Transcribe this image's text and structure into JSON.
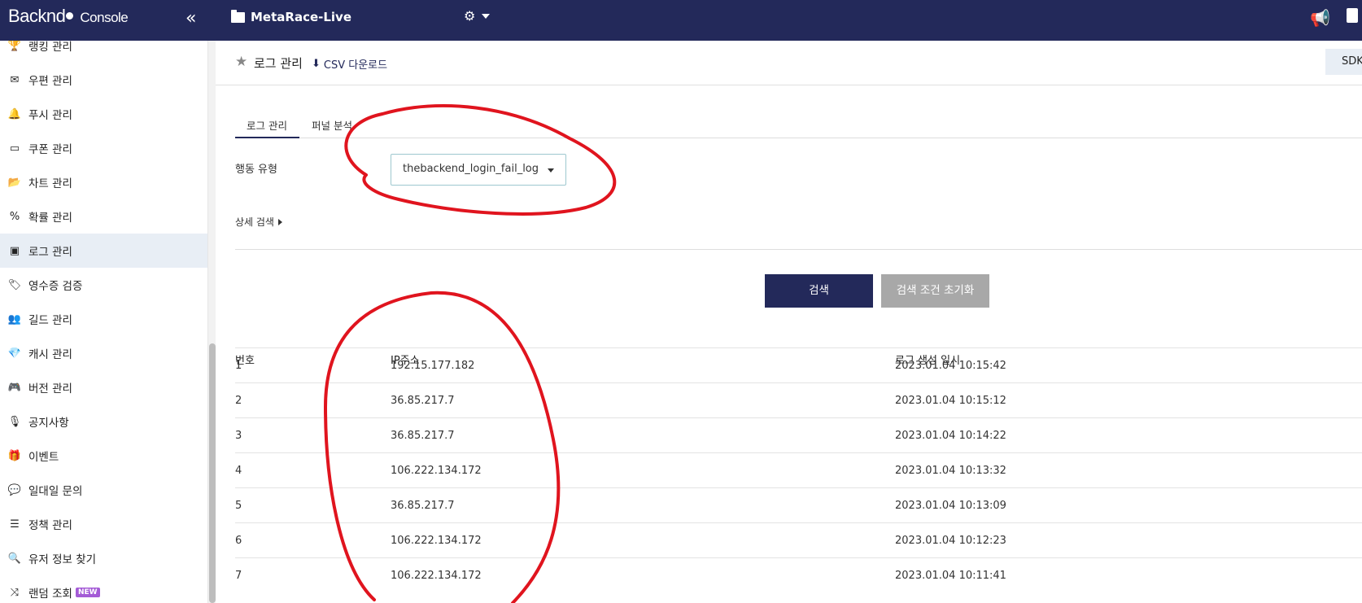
{
  "topbar": {
    "logo_text": "Backnd",
    "console_label": "Console",
    "project_name": "MetaRace-Live"
  },
  "sidebar": {
    "items": [
      {
        "label": "랭킹 관리",
        "icon": "trophy-icon"
      },
      {
        "label": "우편 관리",
        "icon": "envelope-icon"
      },
      {
        "label": "푸시 관리",
        "icon": "bell-icon"
      },
      {
        "label": "쿠폰 관리",
        "icon": "ticket-icon"
      },
      {
        "label": "차트 관리",
        "icon": "folder-open-icon"
      },
      {
        "label": "확률 관리",
        "icon": "percent-icon"
      },
      {
        "label": "로그 관리",
        "icon": "archive-icon",
        "active": true
      },
      {
        "label": "영수증 검증",
        "icon": "tags-icon"
      },
      {
        "label": "길드 관리",
        "icon": "users-icon"
      },
      {
        "label": "캐시 관리",
        "icon": "gem-icon"
      },
      {
        "label": "버전 관리",
        "icon": "gamepad-icon"
      },
      {
        "label": "공지사항",
        "icon": "microphone-icon"
      },
      {
        "label": "이벤트",
        "icon": "gift-icon"
      },
      {
        "label": "일대일 문의",
        "icon": "comment-icon"
      },
      {
        "label": "정책 관리",
        "icon": "list-check-icon"
      },
      {
        "label": "유저 정보 찾기",
        "icon": "search-icon"
      },
      {
        "label": "랜덤 조회",
        "icon": "shuffle-icon",
        "badge": "NEW"
      }
    ]
  },
  "header": {
    "title": "로그 관리",
    "csv_label": "CSV 다운로드",
    "sdk_label": "SDK"
  },
  "tabs": [
    {
      "label": "로그 관리",
      "active": true
    },
    {
      "label": "퍼널 분석",
      "active": false
    }
  ],
  "filter": {
    "label": "행동 유형",
    "selected": "thebackend_login_fail_log"
  },
  "detail_search_label": "상세 검색",
  "buttons": {
    "search": "검색",
    "reset": "검색 조건 초기화"
  },
  "table": {
    "columns": [
      "번호",
      "IP주소",
      "로그 생성 일시"
    ],
    "rows": [
      {
        "no": "1",
        "ip": "192.15.177.182",
        "date": "2023.01.04 10:15:42"
      },
      {
        "no": "2",
        "ip": "36.85.217.7",
        "date": "2023.01.04 10:15:12"
      },
      {
        "no": "3",
        "ip": "36.85.217.7",
        "date": "2023.01.04 10:14:22"
      },
      {
        "no": "4",
        "ip": "106.222.134.172",
        "date": "2023.01.04 10:13:32"
      },
      {
        "no": "5",
        "ip": "36.85.217.7",
        "date": "2023.01.04 10:13:09"
      },
      {
        "no": "6",
        "ip": "106.222.134.172",
        "date": "2023.01.04 10:12:23"
      },
      {
        "no": "7",
        "ip": "106.222.134.172",
        "date": "2023.01.04 10:11:41"
      }
    ]
  },
  "colors": {
    "navy": "#23295a",
    "annotation": "#e0141e"
  }
}
